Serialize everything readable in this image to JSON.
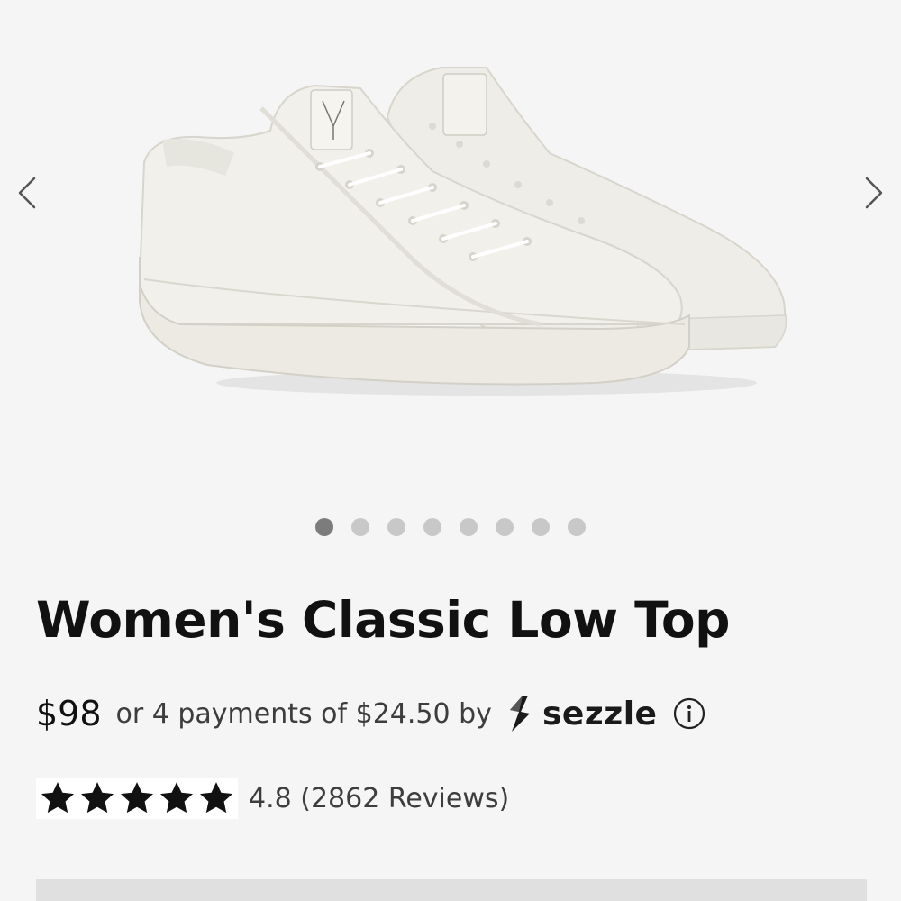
{
  "gallery": {
    "image_alt": "white canvas low top sneakers",
    "prev_icon": "chevron-left-icon",
    "next_icon": "chevron-right-icon",
    "slide_count": 8,
    "active_slide": 1
  },
  "product": {
    "title": "Women's Classic Low Top",
    "price": "$98",
    "installment_text": "or 4 payments of $24.50 by",
    "sezzle_wordmark": "sezzle",
    "info_icon": "info-icon",
    "rating": {
      "stars_filled": 5,
      "text": "4.8 (2862 Reviews)"
    }
  },
  "colors": {
    "background": "#f5f5f5",
    "text": "#111111",
    "muted_text": "#3d3d3d",
    "dot_active": "#7c7c7c",
    "dot_inactive": "#c8c8c8"
  }
}
